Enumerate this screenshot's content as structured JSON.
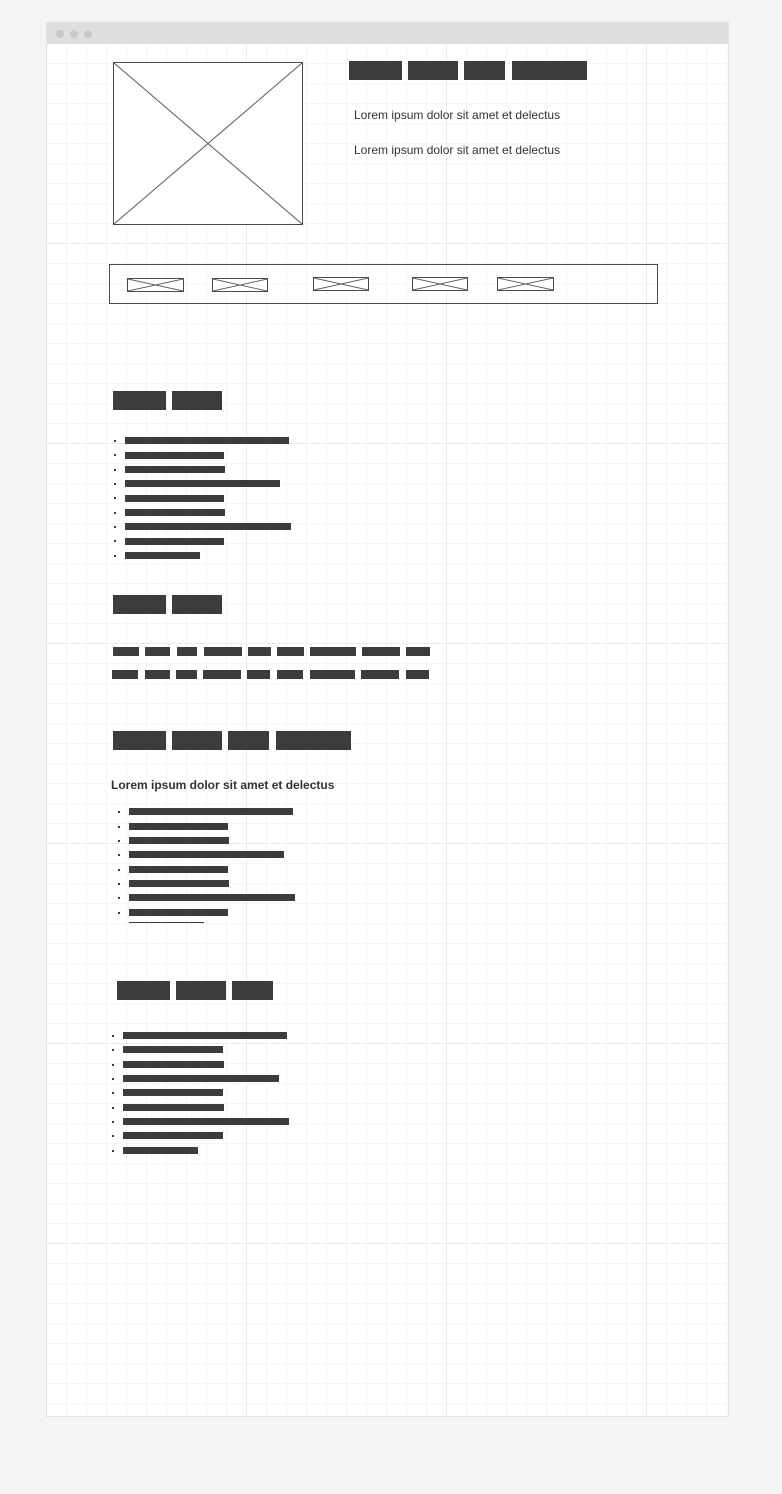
{
  "hero": {
    "paragraph_1": "Lorem ipsum dolor sit amet et delectus",
    "paragraph_2": "Lorem ipsum dolor sit amet et delectus"
  },
  "section_4": {
    "subheading": "Lorem ipsum dolor sit amet et delectus"
  },
  "colors": {
    "page_background": "#f4f4f4",
    "canvas": "#ffffff",
    "grid": "#ececec",
    "placeholder_block": "#3c3c3c",
    "text": "#333333",
    "titlebar": "#dedede"
  },
  "icons": {
    "image_placeholder": "image-placeholder-icon",
    "list_bullet": "bullet-icon"
  }
}
